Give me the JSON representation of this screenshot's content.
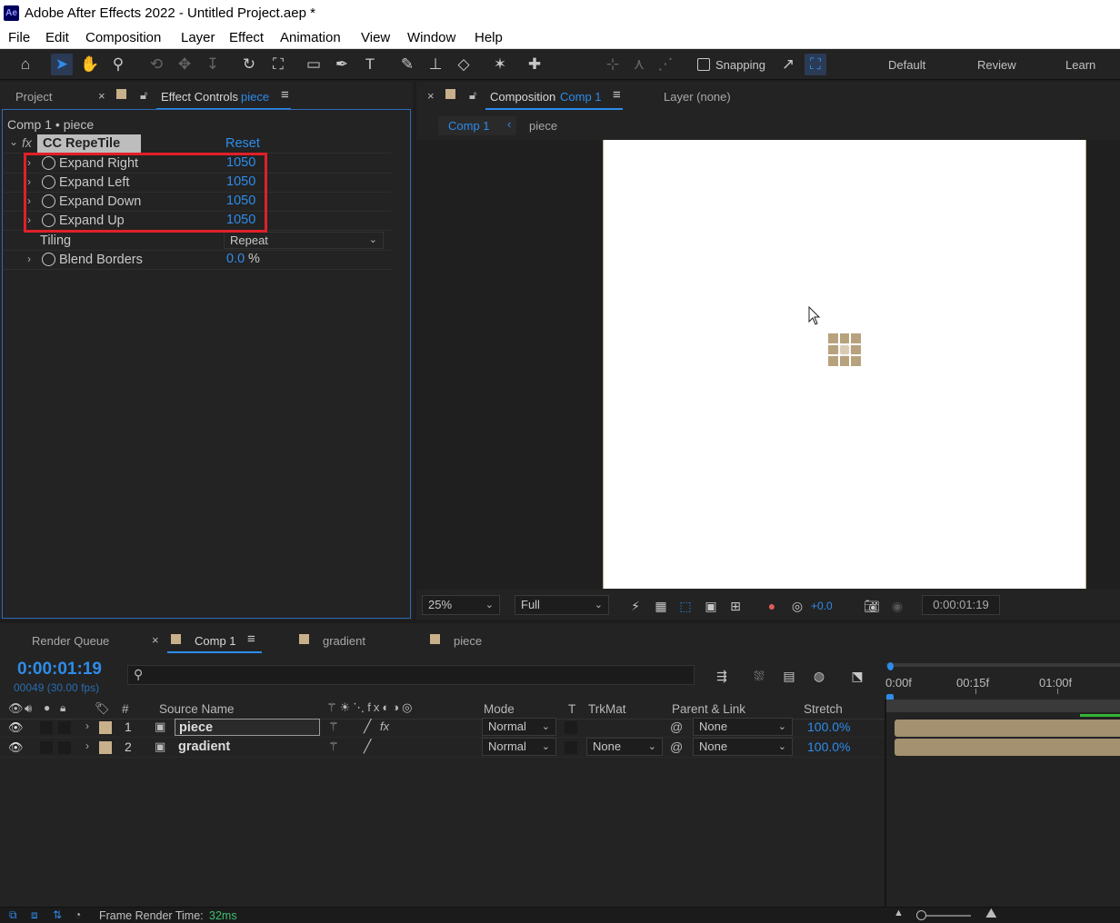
{
  "app": {
    "title": "Adobe After Effects 2022 - Untitled Project.aep *",
    "logo": "Ae"
  },
  "menu": [
    "File",
    "Edit",
    "Composition",
    "Layer",
    "Effect",
    "Animation",
    "View",
    "Window",
    "Help"
  ],
  "toolbar": {
    "snapping_label": "Snapping",
    "workspaces": [
      "Default",
      "Review",
      "Learn"
    ]
  },
  "left_panel": {
    "tab_project": "Project",
    "tab_effect_controls": "Effect Controls",
    "tab_effect_layer": "piece",
    "breadcrumb": "Comp 1 • piece",
    "effect": {
      "name": "CC RepeTile",
      "reset_label": "Reset",
      "props": [
        {
          "label": "Expand Right",
          "value": "1050"
        },
        {
          "label": "Expand Left",
          "value": "1050"
        },
        {
          "label": "Expand Down",
          "value": "1050"
        },
        {
          "label": "Expand Up",
          "value": "1050"
        }
      ],
      "tiling_label": "Tiling",
      "tiling_value": "Repeat",
      "blend_label": "Blend Borders",
      "blend_value": "0.0",
      "blend_unit": "%"
    },
    "highlight_color": "#e0202a"
  },
  "comp_panel": {
    "tab_label": "Composition",
    "tab_comp": "Comp 1",
    "layer_tab": "Layer (none)",
    "crumb_comp": "Comp 1",
    "crumb_layer": "piece",
    "zoom": "25%",
    "resolution": "Full",
    "exposure": "+0.0",
    "timecode": "0:00:01:19"
  },
  "timeline": {
    "tabs": {
      "render_queue": "Render Queue",
      "comp1": "Comp 1",
      "gradient": "gradient",
      "piece": "piece"
    },
    "timecode": "0:00:01:19",
    "frames": "00049 (30.00 fps)",
    "search_placeholder": "",
    "headers": {
      "num": "#",
      "source": "Source Name",
      "mode": "Mode",
      "t": "T",
      "trkmat": "TrkMat",
      "parent": "Parent & Link",
      "stretch": "Stretch"
    },
    "ruler": [
      "0:00f",
      "00:15f",
      "01:00f"
    ],
    "layers": [
      {
        "num": "1",
        "name": "piece",
        "mode": "Normal",
        "trkmat": "",
        "parent": "None",
        "stretch": "100.0%",
        "fx": "fx"
      },
      {
        "num": "2",
        "name": "gradient",
        "mode": "Normal",
        "trkmat": "None",
        "parent": "None",
        "stretch": "100.0%",
        "fx": ""
      }
    ]
  },
  "status": {
    "label": "Frame Render Time:",
    "value": "32ms"
  }
}
